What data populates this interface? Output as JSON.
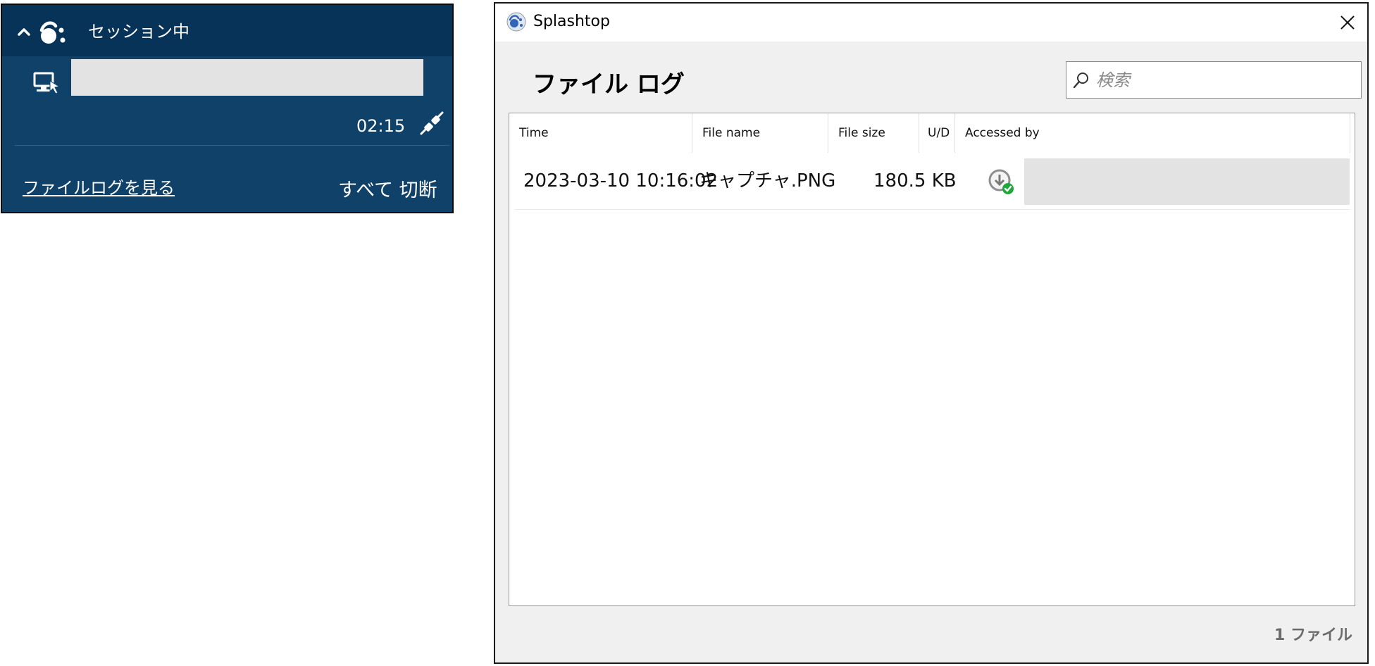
{
  "session_panel": {
    "status_title": "セッション中",
    "computer_name": "",
    "elapsed_time": "02:15",
    "file_log_link": "ファイルログを見る",
    "disconnect_all": "すべて 切断",
    "icons": {
      "collapse": "chevron-up-icon",
      "logo": "splashtop-logo-icon",
      "computer": "monitor-icon",
      "disconnect": "plug-icon"
    },
    "colors": {
      "panel_bg": "#0f4169",
      "header_bg": "#083358"
    }
  },
  "file_log_window": {
    "title": "Splashtop",
    "heading": "ファイル ログ",
    "search": {
      "placeholder": "検索",
      "value": ""
    },
    "columns": [
      "Time",
      "File name",
      "File size",
      "U/D",
      "Accessed by"
    ],
    "rows": [
      {
        "time": "2023-03-10 10:16:02",
        "file_name": "キャプチャ.PNG",
        "file_size": "180.5 KB",
        "ud": "download-complete-icon",
        "accessed_by": ""
      }
    ],
    "file_count": "1 ファイル",
    "colors": {
      "window_bg": "#f0f0f0",
      "success_green": "#1fa83a"
    }
  }
}
